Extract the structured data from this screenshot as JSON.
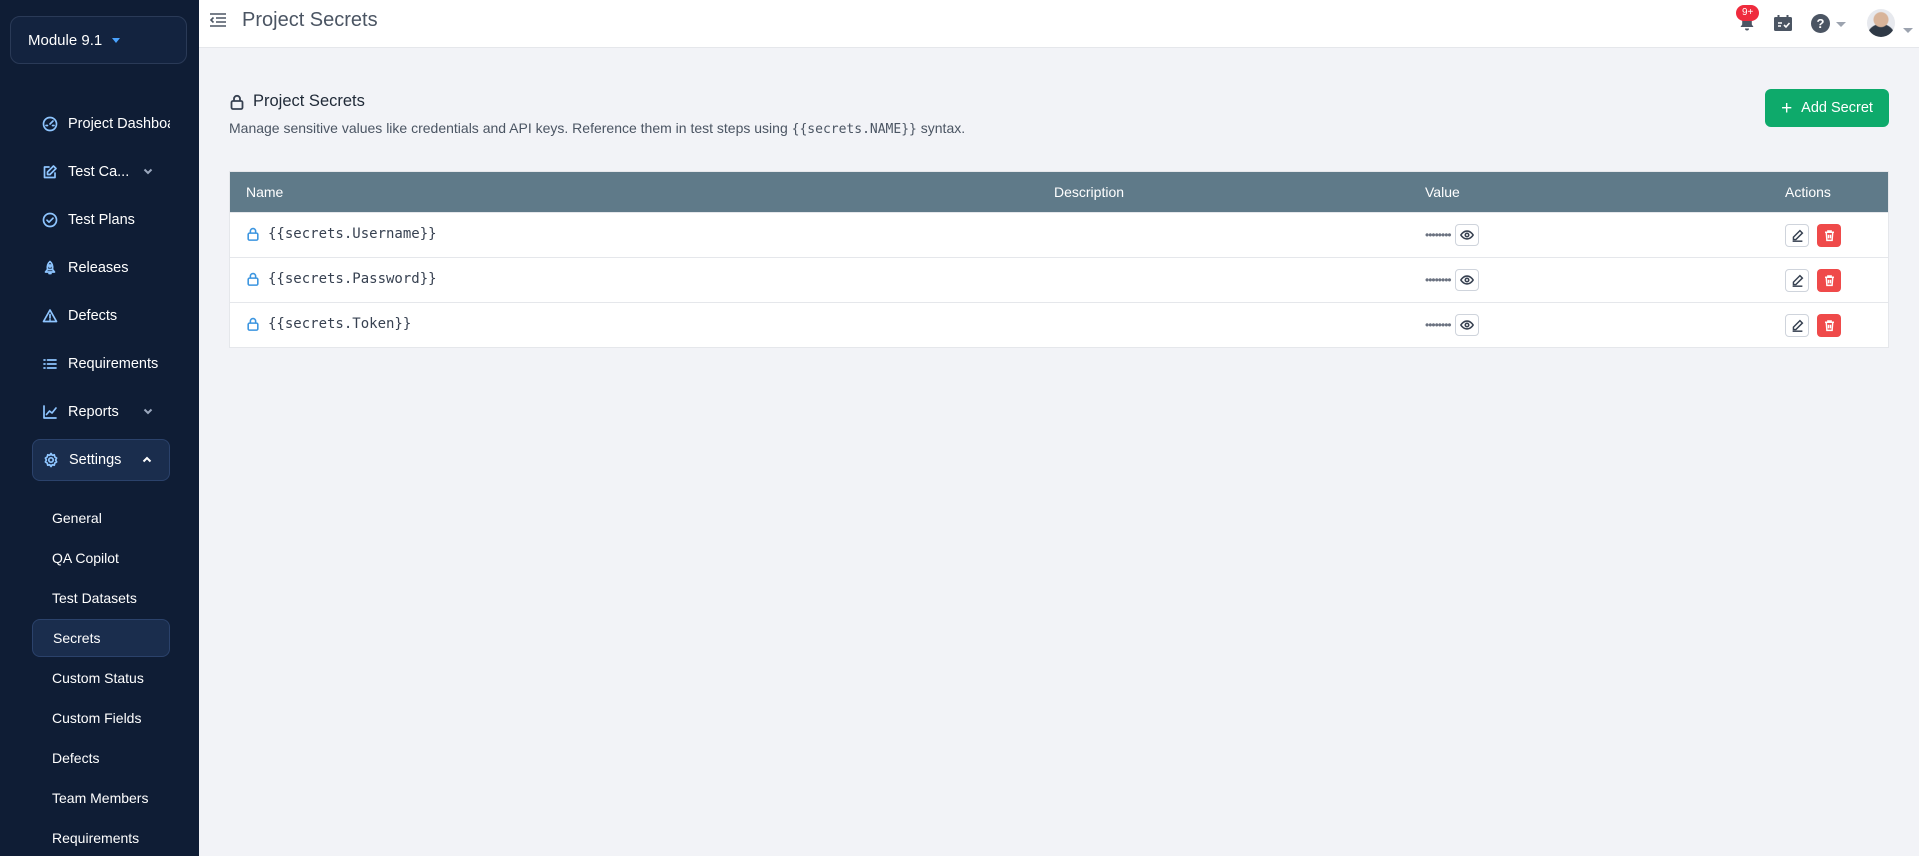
{
  "sidebar": {
    "module_label": "Module 9.1",
    "nav": [
      {
        "label": "Project Dashboa",
        "icon": "dashboard-icon"
      },
      {
        "label": "Test Ca...",
        "icon": "edit-icon",
        "chevron": "down"
      },
      {
        "label": "Test Plans",
        "icon": "check-circle-icon"
      },
      {
        "label": "Releases",
        "icon": "rocket-icon"
      },
      {
        "label": "Defects",
        "icon": "warning-icon"
      },
      {
        "label": "Requirements",
        "icon": "list-icon"
      },
      {
        "label": "Reports",
        "icon": "chart-icon",
        "chevron": "down"
      },
      {
        "label": "Settings",
        "icon": "gear-icon",
        "chevron": "up"
      }
    ],
    "settings_sub": [
      {
        "label": "General"
      },
      {
        "label": "QA Copilot"
      },
      {
        "label": "Test Datasets"
      },
      {
        "label": "Secrets",
        "active": true
      },
      {
        "label": "Custom Status"
      },
      {
        "label": "Custom Fields"
      },
      {
        "label": "Defects"
      },
      {
        "label": "Team Members"
      },
      {
        "label": "Requirements"
      }
    ]
  },
  "topbar": {
    "title": "Project Secrets",
    "notification_badge": "9+"
  },
  "main": {
    "section_title": "Project Secrets",
    "description_prefix": "Manage sensitive values like credentials and API keys. Reference them in test steps using ",
    "description_code": "{{secrets.NAME}}",
    "description_suffix": " syntax.",
    "add_button": "Add Secret",
    "table": {
      "columns": {
        "name": "Name",
        "description": "Description",
        "value": "Value",
        "actions": "Actions"
      },
      "rows": [
        {
          "name": "{{secrets.Username}}",
          "description": "",
          "value": "••••••••"
        },
        {
          "name": "{{secrets.Password}}",
          "description": "",
          "value": "••••••••"
        },
        {
          "name": "{{secrets.Token}}",
          "description": "",
          "value": "••••••••"
        }
      ]
    }
  },
  "colors": {
    "sidebar_bg": "#0f1d35",
    "accent_green": "#0eaa6b",
    "table_header": "#5f7a89",
    "danger": "#ef4a4a",
    "badge": "#ef2b3d"
  }
}
